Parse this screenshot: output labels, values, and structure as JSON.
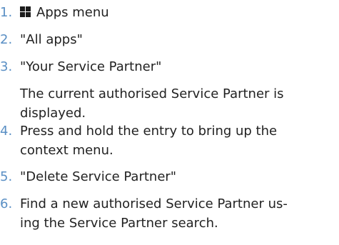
{
  "steps": [
    {
      "number": "1.",
      "icon": "apps-grid-icon",
      "text": "Apps menu"
    },
    {
      "number": "2.",
      "text": "\"All apps\""
    },
    {
      "number": "3.",
      "text": "\"Your Service Partner\"",
      "note_lines": [
        "The current authorised Service Partner is",
        "displayed."
      ]
    },
    {
      "number": "4.",
      "lines": [
        "Press and hold the entry to bring up the",
        "context menu."
      ]
    },
    {
      "number": "5.",
      "text": "\"Delete Service Partner\""
    },
    {
      "number": "6.",
      "lines": [
        "Find a new authorised Service Partner us-",
        "ing the Service Partner search."
      ]
    }
  ]
}
